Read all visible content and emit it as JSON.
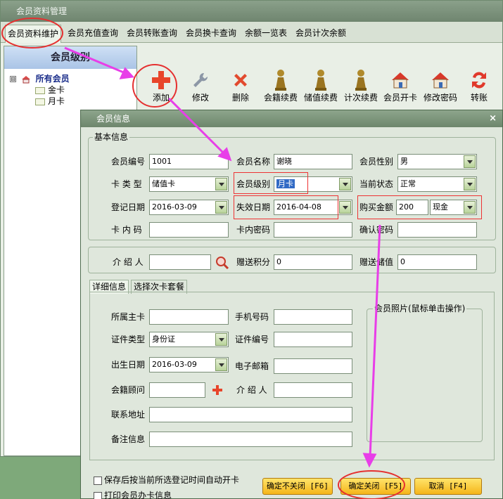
{
  "window": {
    "title": "会员资料管理"
  },
  "tabs": [
    "会员资料维护",
    "会员充值查询",
    "会员转账查询",
    "会员换卡查询",
    "余额一览表",
    "会员计次余额"
  ],
  "tree": {
    "header": "会员级别",
    "root": "所有会员",
    "children": [
      "金卡",
      "月卡"
    ],
    "expander": "⊟"
  },
  "toolbar": [
    "添加",
    "修改",
    "删除",
    "会籍续费",
    "储值续费",
    "计次续费",
    "会员开卡",
    "修改密码",
    "转账"
  ],
  "dialog": {
    "title": "会员信息",
    "close": "×",
    "basic": {
      "group_title": "基本信息",
      "member_no_label": "会员编号",
      "member_no": "1001",
      "member_name_label": "会员名称",
      "member_name": "谢晓",
      "gender_label": "会员性别",
      "gender": "男",
      "card_type_label": "卡 类 型",
      "card_type": "储值卡",
      "level_label": "会员级别",
      "level": "月卡",
      "status_label": "当前状态",
      "status": "正常",
      "reg_date_label": "登记日期",
      "reg_date": "2016-03-09",
      "expire_label": "失效日期",
      "expire_date": "2016-04-08",
      "amount_label": "购买金额",
      "amount": "200",
      "pay_method": "现金",
      "inner_code_label": "卡 内 码",
      "inner_code": "",
      "card_pwd_label": "卡内密码",
      "card_pwd": "",
      "confirm_pwd_label": "确认密码",
      "confirm_pwd": ""
    },
    "intro": {
      "introducer_label": "介 绍 人",
      "introducer": "",
      "gift_points_label": "赠送积分",
      "gift_points": "0",
      "gift_stored_label": "赠送储值",
      "gift_stored": "0"
    },
    "subtabs": [
      "详细信息",
      "选择次卡套餐"
    ],
    "detail": {
      "main_card_label": "所属主卡",
      "main_card": "",
      "phone_label": "手机号码",
      "phone": "",
      "id_type_label": "证件类型",
      "id_type": "身份证",
      "id_no_label": "证件编号",
      "id_no": "",
      "birth_label": "出生日期",
      "birth": "2016-03-09",
      "email_label": "电子邮箱",
      "email": "",
      "advisor_label": "会籍顾问",
      "advisor": "",
      "introducer_label": "介 绍 人",
      "introducer": "",
      "address_label": "联系地址",
      "address": "",
      "remark_label": "备注信息",
      "remark": "",
      "photo_title": "会员照片(鼠标单击操作)"
    },
    "options": {
      "auto_open": "保存后按当前所选登记时间自动开卡",
      "print": "打印会员办卡信息"
    },
    "buttons": {
      "confirm_keep": "确定不关闭 [F6]",
      "confirm_close": "确定关闭 [F5]",
      "cancel": "取消 [F4]"
    }
  },
  "colors": {
    "annotation_red": "#e53030",
    "annotation_arrow": "#e83ee8",
    "button_yellow": "#f5b51a"
  }
}
